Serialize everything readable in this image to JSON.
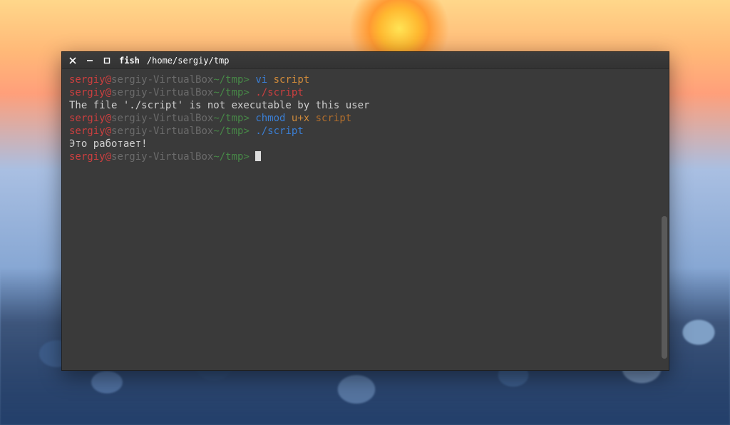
{
  "window": {
    "title_main": "fish",
    "title_sub": "/home/sergiy/tmp"
  },
  "prompt": {
    "user": "sergiy",
    "at": "@",
    "host": "sergiy-VirtualBox",
    "path": "~/tmp",
    "sep": "> "
  },
  "lines": [
    {
      "type": "prompt",
      "segments": [
        {
          "cls": "cmd-blue",
          "text": "vi "
        },
        {
          "cls": "cmd-arg",
          "text": "script"
        }
      ]
    },
    {
      "type": "prompt",
      "segments": [
        {
          "cls": "cmd-red",
          "text": "./script"
        }
      ]
    },
    {
      "type": "output",
      "text": "The file './script' is not executable by this user"
    },
    {
      "type": "prompt",
      "segments": [
        {
          "cls": "cmd-blue",
          "text": "chmod "
        },
        {
          "cls": "cmd-arg",
          "text": "u+x "
        },
        {
          "cls": "cmd-arg2",
          "text": "script"
        }
      ]
    },
    {
      "type": "prompt",
      "segments": [
        {
          "cls": "cmd-blue",
          "text": "./script"
        }
      ]
    },
    {
      "type": "output",
      "text": "Это работает!"
    },
    {
      "type": "prompt",
      "segments": [],
      "cursor": true
    }
  ]
}
